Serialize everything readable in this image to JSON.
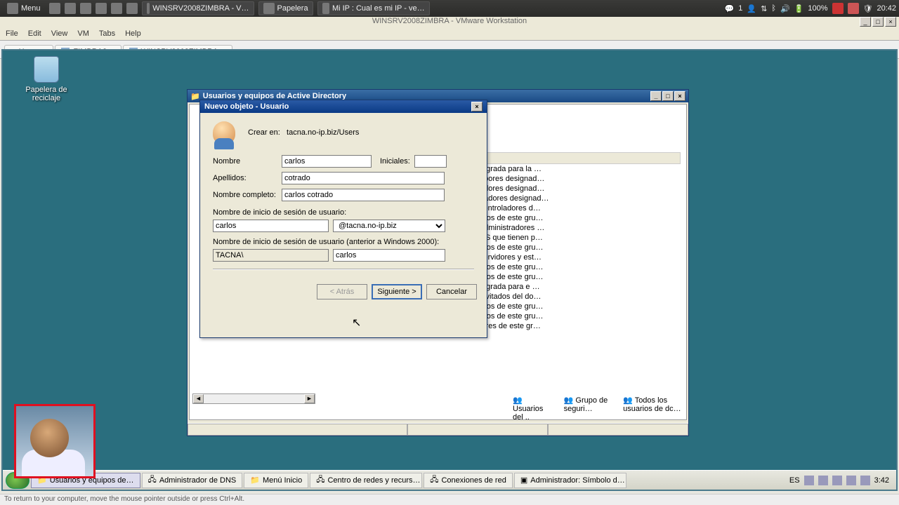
{
  "host": {
    "menu": "Menu",
    "task1": "WINSRV2008ZIMBRA - V…",
    "task2": "Papelera",
    "task3": "Mi IP : Cual es mi IP - ve…",
    "battery": "100%",
    "time": "20:42",
    "users": "1"
  },
  "vm_title": "WINSRV2008ZIMBRA - VMware Workstation",
  "vm_menu": {
    "file": "File",
    "edit": "Edit",
    "view": "View",
    "vm": "VM",
    "tabs": "Tabs",
    "help": "Help"
  },
  "vm_tabs": {
    "home": "Home",
    "t1": "ZIMBRA2",
    "t2": "WINSRV2008ZIMBRA"
  },
  "deskicon": "Papelera de reciclaje",
  "ad_window": {
    "title": "Usuarios y equipos de Active Directory",
    "col": "n"
  },
  "ad_rows": [
    "tegrada para la …",
    "obores designad…",
    "adores designad…",
    "nadores designad…",
    "controladores d…",
    "bros de este gru…",
    "administradores …",
    "NS que tienen p…",
    "bros de este gru…",
    "servidores y est…",
    "bros de este gru…",
    "bros de este gru…",
    "tegrada para e …",
    "invitados del do…",
    "bros de este gru…",
    "bros de este gru…",
    "lores de este gr…"
  ],
  "bgrow": {
    "a": "Usuarios del ..",
    "b": "Grupo de seguri…",
    "c": "Todos los usuarios de dc…"
  },
  "dlg": {
    "title": "Nuevo objeto - Usuario",
    "create_in": "Crear en:",
    "path": "tacna.no-ip.biz/Users",
    "nombre_lbl": "Nombre",
    "nombre": "carlos",
    "iniciales_lbl": "Iniciales:",
    "iniciales": "",
    "apellidos_lbl": "Apellidos:",
    "apellidos": "cotrado",
    "nombrecomp_lbl": "Nombre completo:",
    "nombrecomp": "carlos cotrado",
    "logon_lbl": "Nombre de inicio de sesión de usuario:",
    "logon": "carlos",
    "domain": "@tacna.no-ip.biz",
    "logon2000_lbl": "Nombre de inicio de sesión de usuario (anterior a Windows 2000):",
    "netbios": "TACNA\\",
    "logon2000": "carlos",
    "back": "< Atrás",
    "next": "Siguiente >",
    "cancel": "Cancelar"
  },
  "guest_taskbar": {
    "t1": "Usuarios y equipos de…",
    "t2": "Administrador de DNS",
    "t3": "Menú Inicio",
    "t4": "Centro de redes y recurs…",
    "t5": "Conexiones de red",
    "t6": "Administrador: Símbolo d…",
    "lang": "ES",
    "time": "3:42"
  },
  "host_status": "To return to your computer, move the mouse pointer outside or press Ctrl+Alt."
}
